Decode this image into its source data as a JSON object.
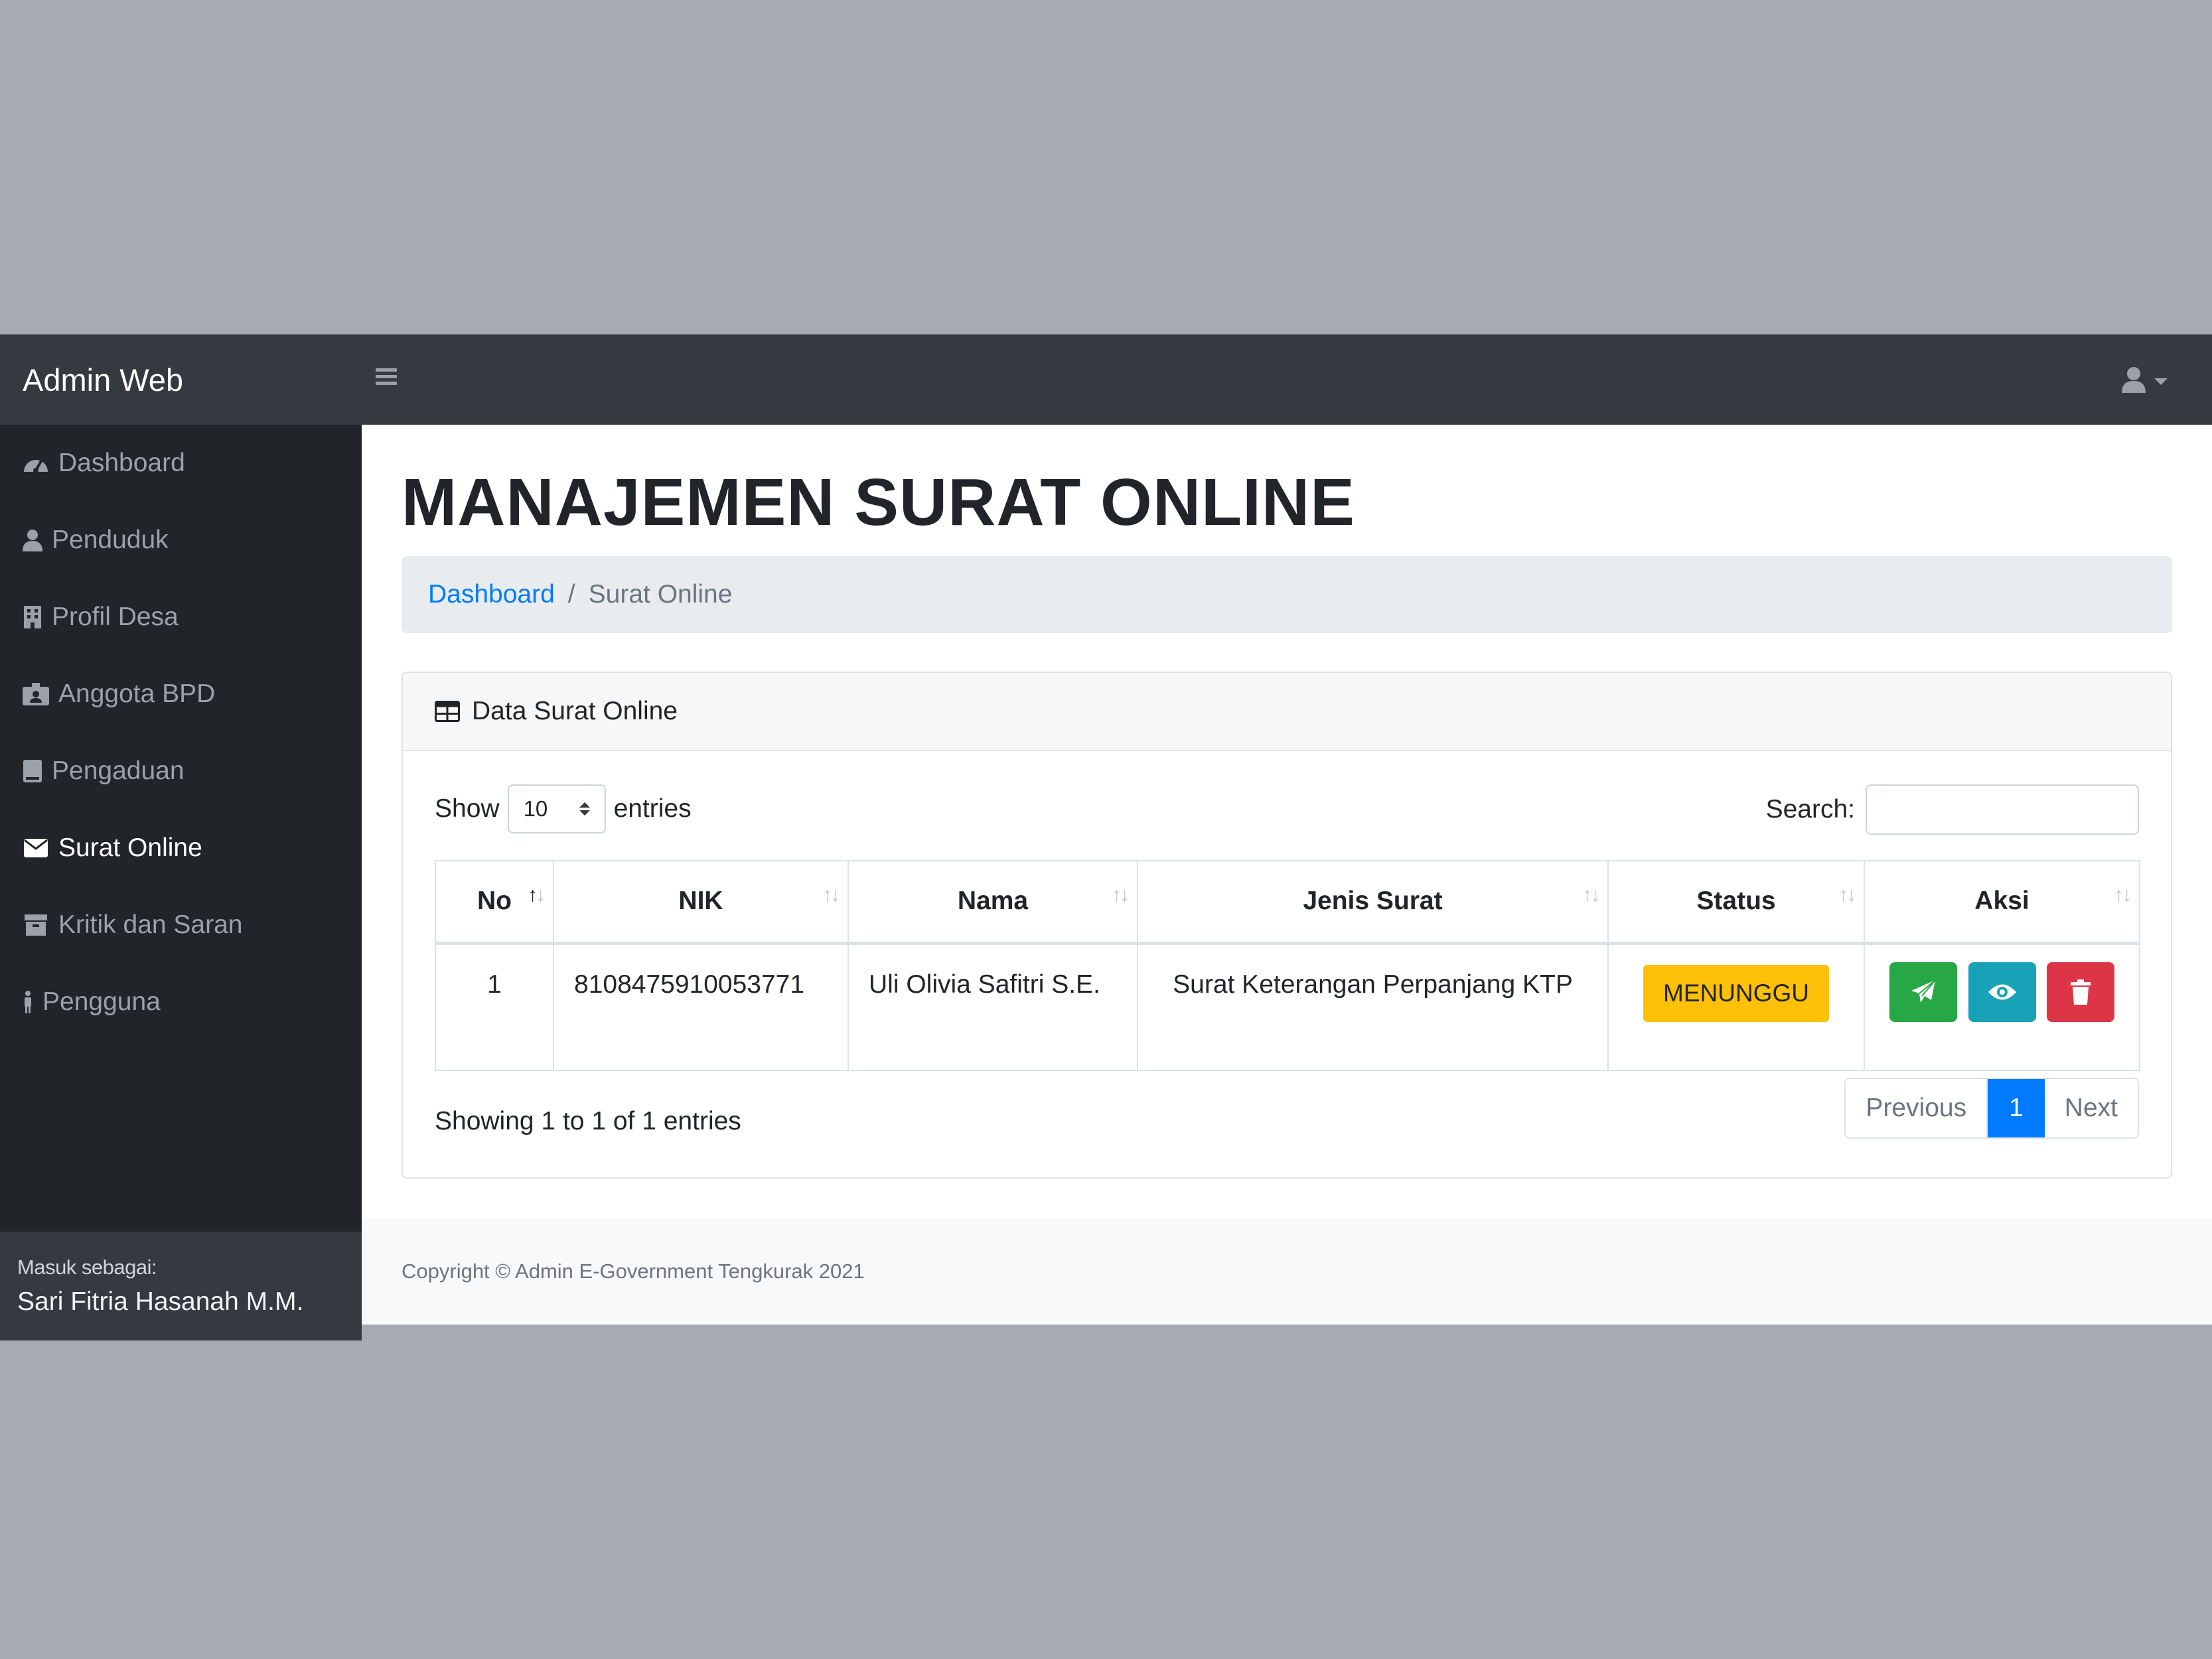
{
  "navbar": {
    "brand": "Admin Web",
    "toggle_icon": "hamburger-icon",
    "user_icon": "user-icon"
  },
  "sidebar": {
    "items": [
      {
        "label": "Dashboard",
        "icon": "tachometer-icon",
        "active": false
      },
      {
        "label": "Penduduk",
        "icon": "user-icon",
        "active": false
      },
      {
        "label": "Profil Desa",
        "icon": "building-icon",
        "active": false
      },
      {
        "label": "Anggota BPD",
        "icon": "id-badge-icon",
        "active": false
      },
      {
        "label": "Pengaduan",
        "icon": "book-icon",
        "active": false
      },
      {
        "label": "Surat Online",
        "icon": "envelope-icon",
        "active": true
      },
      {
        "label": "Kritik dan Saran",
        "icon": "archive-icon",
        "active": false
      },
      {
        "label": "Pengguna",
        "icon": "male-icon",
        "active": false
      }
    ],
    "footer": {
      "label": "Masuk sebagai:",
      "name": "Sari Fitria Hasanah M.M."
    }
  },
  "main": {
    "title": "MANAJEMEN SURAT ONLINE",
    "breadcrumb": {
      "link": "Dashboard",
      "separator": "/",
      "current": "Surat Online"
    },
    "card": {
      "header": "Data Surat Online",
      "header_icon": "table-icon",
      "show_label": "Show",
      "entries_label": "entries",
      "page_size": "10",
      "search_label": "Search:",
      "search_value": "",
      "columns": [
        "No",
        "NIK",
        "Nama",
        "Jenis Surat",
        "Status",
        "Aksi"
      ],
      "rows": [
        {
          "no": "1",
          "nik": "8108475910053771",
          "nama": "Uli Olivia Safitri S.E.",
          "jenis_surat": "Surat Keterangan Perpanjang KTP",
          "status": "MENUNGGU"
        }
      ],
      "info": "Showing 1 to 1 of 1 entries",
      "pagination": {
        "previous": "Previous",
        "current": "1",
        "next": "Next"
      }
    }
  },
  "footer": {
    "copyright": "Copyright © Admin E-Government Tengkurak 2021"
  },
  "colors": {
    "navbar": "#343a40",
    "sidebar": "#212529",
    "primary": "#007bff",
    "warning": "#ffc107",
    "success": "#28a745",
    "info": "#17a2b8",
    "danger": "#dc3545"
  }
}
